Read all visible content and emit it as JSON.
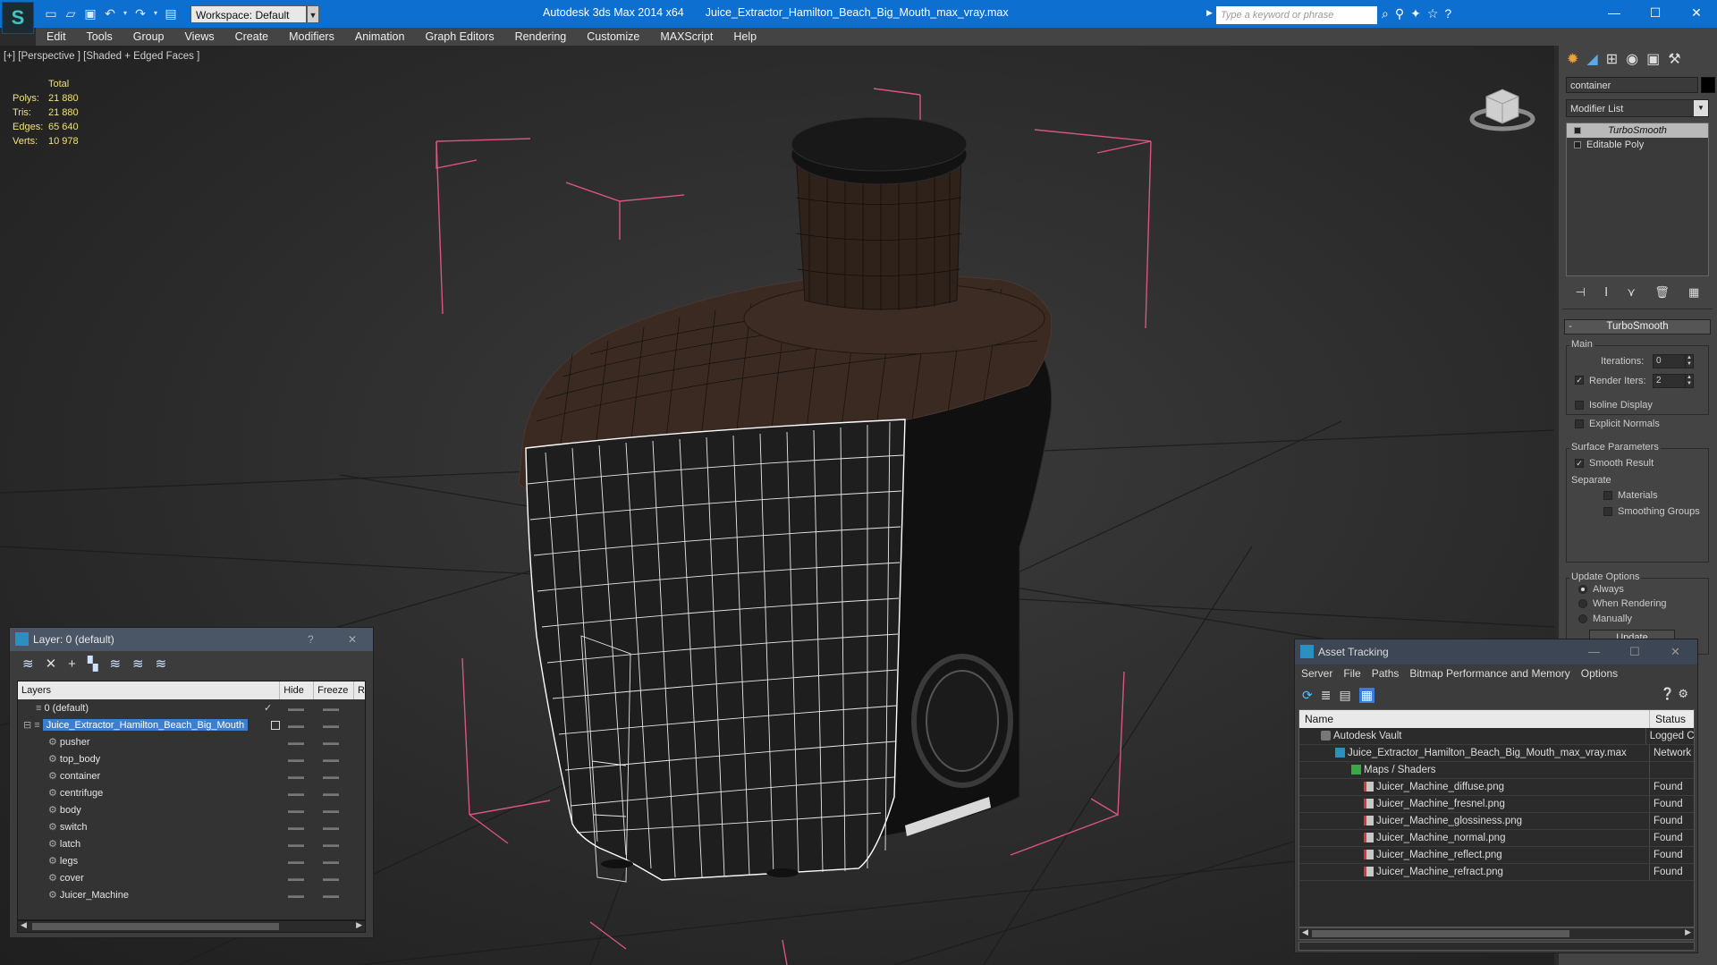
{
  "title": {
    "app_name": "Autodesk 3ds Max  2014 x64",
    "file_name": "Juice_Extractor_Hamilton_Beach_Big_Mouth_max_vray.max",
    "workspace": "Workspace: Default",
    "search_placeholder": "Type a keyword or phrase"
  },
  "menu": [
    "Edit",
    "Tools",
    "Group",
    "Views",
    "Create",
    "Modifiers",
    "Animation",
    "Graph Editors",
    "Rendering",
    "Customize",
    "MAXScript",
    "Help"
  ],
  "viewport": {
    "label": "[+] [Perspective ] [Shaded + Edged Faces ]",
    "stats": {
      "header": "Total",
      "polys_label": "Polys:",
      "polys": "21 880",
      "tris_label": "Tris:",
      "tris": "21 880",
      "edges_label": "Edges:",
      "edges": "65 640",
      "verts_label": "Verts:",
      "verts": "10 978"
    }
  },
  "layer_window": {
    "title": "Layer: 0 (default)",
    "help": "?",
    "close": "✕",
    "columns": {
      "layers": "Layers",
      "hide": "Hide",
      "freeze": "Freeze",
      "render": "R"
    },
    "rows": [
      {
        "name": "0 (default)"
      },
      {
        "name": "Juice_Extractor_Hamilton_Beach_Big_Mouth"
      },
      {
        "name": "pusher"
      },
      {
        "name": "top_body"
      },
      {
        "name": "container"
      },
      {
        "name": "centrifuge"
      },
      {
        "name": "body"
      },
      {
        "name": "switch"
      },
      {
        "name": "latch"
      },
      {
        "name": "legs"
      },
      {
        "name": "cover"
      },
      {
        "name": "Juicer_Machine"
      }
    ]
  },
  "command_panel": {
    "object_name": "container",
    "modifier_list": "Modifier List",
    "stack": [
      "TurboSmooth",
      "Editable Poly"
    ],
    "rollout_title": "TurboSmooth",
    "collapse": "-",
    "main_group": "Main",
    "iterations_label": "Iterations:",
    "iterations": "0",
    "render_iters_label": "Render Iters:",
    "render_iters": "2",
    "isoline": "Isoline Display",
    "explicit_normals": "Explicit Normals",
    "surface_group": "Surface Parameters",
    "smooth_result": "Smooth Result",
    "separate": "Separate",
    "materials": "Materials",
    "smoothing_groups": "Smoothing Groups",
    "update_group": "Update Options",
    "always": "Always",
    "when_rendering": "When Rendering",
    "manually": "Manually",
    "update_button": "Update"
  },
  "asset_window": {
    "title": "Asset Tracking",
    "menu": [
      "Server",
      "File",
      "Paths",
      "Bitmap Performance and Memory",
      "Options"
    ],
    "col_name": "Name",
    "col_status": "Status",
    "rows": [
      {
        "name": "Autodesk Vault",
        "status": "Logged C"
      },
      {
        "name": "Juice_Extractor_Hamilton_Beach_Big_Mouth_max_vray.max",
        "status": "Network"
      },
      {
        "name": "Maps / Shaders",
        "status": ""
      },
      {
        "name": "Juicer_Machine_diffuse.png",
        "status": "Found"
      },
      {
        "name": "Juicer_Machine_fresnel.png",
        "status": "Found"
      },
      {
        "name": "Juicer_Machine_glossiness.png",
        "status": "Found"
      },
      {
        "name": "Juicer_Machine_normal.png",
        "status": "Found"
      },
      {
        "name": "Juicer_Machine_reflect.png",
        "status": "Found"
      },
      {
        "name": "Juicer_Machine_refract.png",
        "status": "Found"
      }
    ]
  },
  "colors": {
    "titlebar": "#0d6fcf",
    "selection": "#3c7fd1",
    "stats": "#f0e27a",
    "bbox": "#d8557e"
  }
}
